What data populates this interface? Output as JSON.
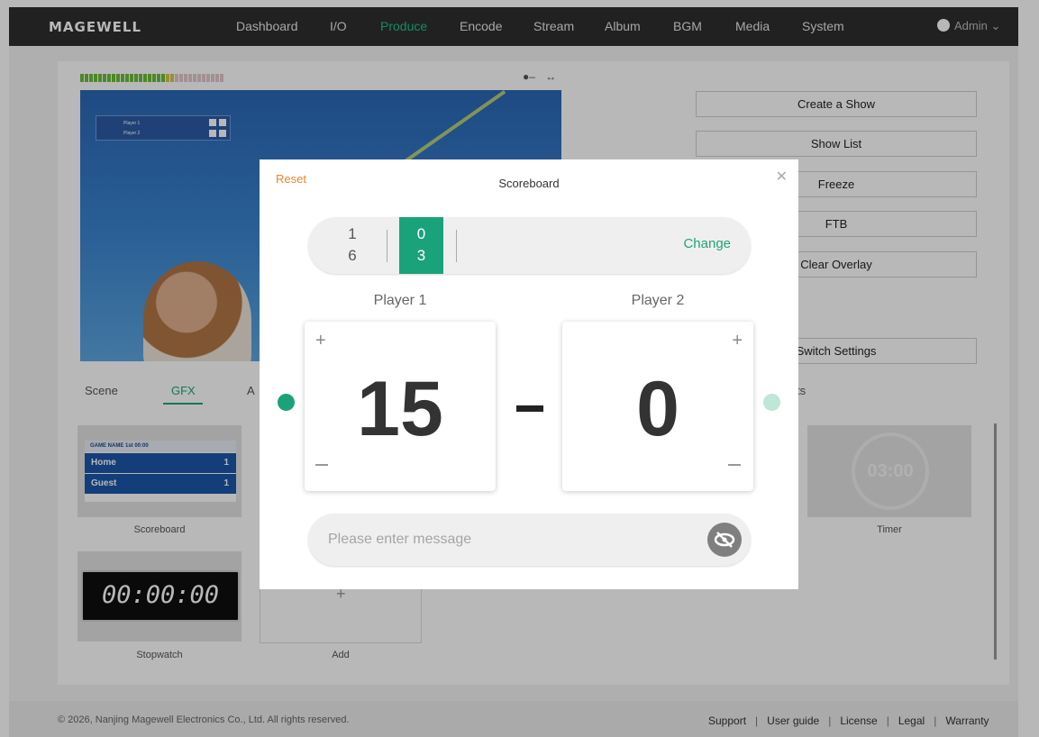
{
  "app": {
    "brand": "MAGEWELL",
    "user": "Admin"
  },
  "nav": {
    "items": [
      "Dashboard",
      "I/O",
      "Produce",
      "Encode",
      "Stream",
      "Album",
      "BGM",
      "Media",
      "System"
    ],
    "active": "Produce"
  },
  "accent_color": "#1aa37a",
  "warning_color": "#e9862b",
  "preview": {
    "overlay_player1": "Player 1",
    "overlay_player2": "Player 2"
  },
  "actions": [
    "Create a Show",
    "Show List",
    "Freeze",
    "FTB",
    "Clear Overlay",
    "Switch Settings"
  ],
  "tabs": {
    "items": [
      "Scene",
      "GFX",
      "A",
      "ts"
    ],
    "active": "GFX"
  },
  "gfx_items": {
    "scoreboard": {
      "label": "Scoreboard",
      "thumb_header": "GAME NAME  1st  00:00",
      "home": "Home",
      "home_value": "1",
      "guest": "Guest",
      "guest_value": "1"
    },
    "stopwatch": {
      "label": "Stopwatch",
      "display": "00:00:00"
    },
    "timer": {
      "label": "Timer",
      "display": "03:00"
    },
    "add": {
      "label": "Add"
    }
  },
  "footer": {
    "copyright": "© 2026, Nanjing Magewell Electronics Co., Ltd. All rights reserved.",
    "links": [
      "Support",
      "User guide",
      "License",
      "Legal",
      "Warranty"
    ]
  },
  "modal": {
    "title": "Scoreboard",
    "reset_label": "Reset",
    "close_icon": "close-icon",
    "sets": {
      "previous": {
        "player1": "1",
        "player2": "6"
      },
      "current": {
        "player1": "0",
        "player2": "3"
      },
      "change_label": "Change"
    },
    "player1": {
      "name": "Player 1",
      "score": "15",
      "serving": true
    },
    "player2": {
      "name": "Player 2",
      "score": "0",
      "serving": false
    },
    "message": {
      "placeholder": "Please enter message",
      "value": ""
    }
  }
}
